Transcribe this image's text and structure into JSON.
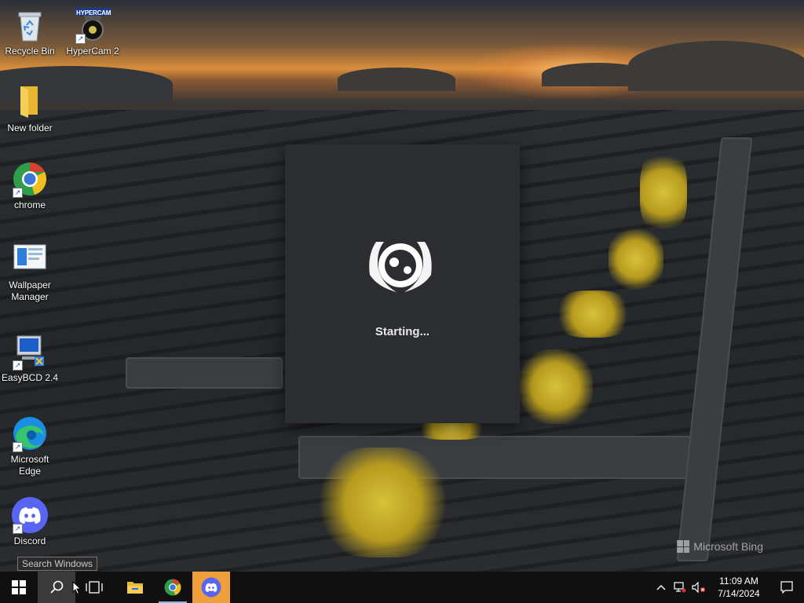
{
  "desktop": {
    "icons": [
      {
        "label": "Recycle Bin",
        "icon": "recycle-bin-icon"
      },
      {
        "label": "HyperCam 2",
        "icon": "hypercam-icon",
        "badge": "HYPERCAM"
      },
      {
        "label": "New folder",
        "icon": "folder-icon"
      },
      {
        "label": "chrome",
        "icon": "chrome-icon"
      },
      {
        "label": "Wallpaper Manager",
        "icon": "wallpaper-manager-icon"
      },
      {
        "label": "EasyBCD 2.4",
        "icon": "easybcd-icon"
      },
      {
        "label": "Microsoft Edge",
        "icon": "edge-icon"
      },
      {
        "label": "Discord",
        "icon": "discord-icon"
      }
    ],
    "watermark": "Microsoft Bing"
  },
  "splash": {
    "app": "Discord",
    "status": "Starting..."
  },
  "tooltip": "Search Windows",
  "taskbar": {
    "buttons": [
      {
        "name": "start-button",
        "icon": "windows-logo-icon"
      },
      {
        "name": "search-button",
        "icon": "search-icon"
      },
      {
        "name": "task-view-button",
        "icon": "task-view-icon"
      },
      {
        "name": "file-explorer-button",
        "icon": "file-explorer-icon"
      },
      {
        "name": "chrome-taskbar-button",
        "icon": "chrome-icon"
      },
      {
        "name": "discord-taskbar-button",
        "icon": "discord-icon"
      }
    ],
    "tray": {
      "time": "11:09 AM",
      "date": "7/14/2024"
    }
  },
  "colors": {
    "discord_blurple": "#5865f2",
    "splash_bg": "#2b2d31",
    "taskbar_bg": "#101010",
    "discord_active": "#f0a03a"
  }
}
